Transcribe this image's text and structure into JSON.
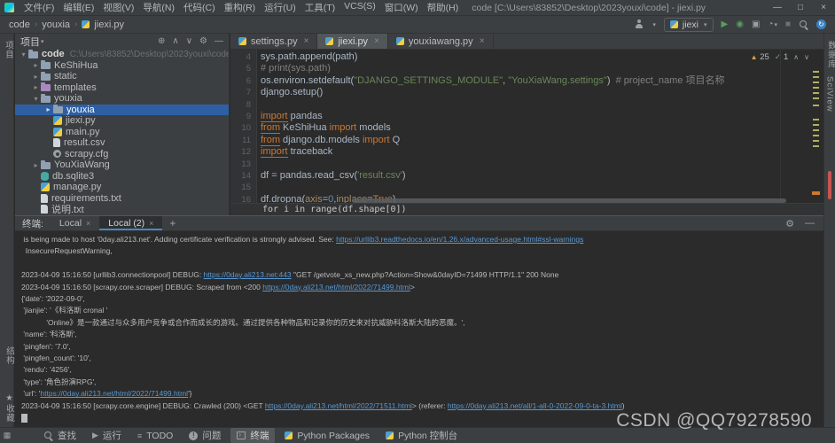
{
  "window": {
    "title": "code [C:\\Users\\83852\\Desktop\\2023youxi\\code] - jiexi.py",
    "menus": [
      "文件(F)",
      "编辑(E)",
      "视图(V)",
      "导航(N)",
      "代码(C)",
      "重构(R)",
      "运行(U)",
      "工具(T)",
      "VCS(S)",
      "窗口(W)",
      "帮助(H)"
    ],
    "controls": {
      "minimize": "—",
      "maximize": "□",
      "close": "×"
    }
  },
  "navbar": {
    "breadcrumbs": [
      "code",
      "youxia",
      "jiexi.py"
    ],
    "run_config": "jiexi"
  },
  "left_stripe": {
    "top": "项目",
    "bottom1": "结构",
    "bottom2": "收藏",
    "star": "★"
  },
  "right_stripe": {
    "labels": [
      "数据库",
      "SciView"
    ]
  },
  "project": {
    "header": "项目",
    "header_icons": [
      "⊕",
      "∧",
      "∨",
      "⚙",
      "—"
    ],
    "tree": [
      {
        "label": "code",
        "path": "C:\\Users\\83852\\Desktop\\2023youxi\\code",
        "level": 0,
        "icon": "folder",
        "chev": "v",
        "bold": true
      },
      {
        "label": "KeShiHua",
        "level": 1,
        "icon": "folder",
        "chev": ">"
      },
      {
        "label": "static",
        "level": 1,
        "icon": "folder",
        "chev": ">"
      },
      {
        "label": "templates",
        "level": 1,
        "icon": "folder-purple",
        "chev": ">"
      },
      {
        "label": "youxia",
        "level": 1,
        "icon": "folder",
        "chev": "v"
      },
      {
        "label": "youxia",
        "level": 2,
        "icon": "folder",
        "chev": ">",
        "selected": true
      },
      {
        "label": "jiexi.py",
        "level": 2,
        "icon": "py"
      },
      {
        "label": "main.py",
        "level": 2,
        "icon": "py"
      },
      {
        "label": "result.csv",
        "level": 2,
        "icon": "file"
      },
      {
        "label": "scrapy.cfg",
        "level": 2,
        "icon": "cfg"
      },
      {
        "label": "YouXiaWang",
        "level": 1,
        "icon": "folder",
        "chev": ">"
      },
      {
        "label": "db.sqlite3",
        "level": 1,
        "icon": "db"
      },
      {
        "label": "manage.py",
        "level": 1,
        "icon": "py"
      },
      {
        "label": "requirements.txt",
        "level": 1,
        "icon": "file"
      },
      {
        "label": "说明.txt",
        "level": 1,
        "icon": "file"
      }
    ]
  },
  "editor": {
    "tabs": [
      {
        "label": "settings.py"
      },
      {
        "label": "jiexi.py",
        "active": true
      },
      {
        "label": "youxiawang.py"
      }
    ],
    "warnings": "25",
    "ok": "1",
    "sticky_line": "for i in range(df.shape[0])",
    "lines": [
      {
        "num": "4",
        "seg": [
          {
            "k": "p",
            "t": "sys.path.append(path)"
          }
        ]
      },
      {
        "num": "5",
        "seg": [
          {
            "k": "c",
            "t": "# print(sys.path)"
          }
        ]
      },
      {
        "num": "6",
        "seg": [
          {
            "k": "p",
            "t": "os.environ.setdefault("
          },
          {
            "k": "s",
            "t": "\"DJANGO_SETTINGS_MODULE\""
          },
          {
            "k": "p",
            "t": ", "
          },
          {
            "k": "s",
            "t": "\"YouXiaWang.settings\""
          },
          {
            "k": "p",
            "t": ")  "
          },
          {
            "k": "c",
            "t": "# project_name 项目名称"
          }
        ]
      },
      {
        "num": "7",
        "seg": [
          {
            "k": "p",
            "t": "django.setup()"
          }
        ]
      },
      {
        "num": "8",
        "seg": []
      },
      {
        "num": "9",
        "seg": [
          {
            "k": "ku",
            "t": "import"
          },
          {
            "k": "p",
            "t": " pandas"
          }
        ]
      },
      {
        "num": "10",
        "seg": [
          {
            "k": "ku",
            "t": "from"
          },
          {
            "k": "p",
            "t": " KeShiHua "
          },
          {
            "k": "k",
            "t": "import"
          },
          {
            "k": "p",
            "t": " models"
          }
        ]
      },
      {
        "num": "11",
        "seg": [
          {
            "k": "ku",
            "t": "from"
          },
          {
            "k": "p",
            "t": " django.db.models "
          },
          {
            "k": "k",
            "t": "import"
          },
          {
            "k": "p",
            "t": " Q"
          }
        ]
      },
      {
        "num": "12",
        "seg": [
          {
            "k": "ku",
            "t": "import"
          },
          {
            "k": "p",
            "t": " traceback"
          }
        ]
      },
      {
        "num": "13",
        "seg": []
      },
      {
        "num": "14",
        "seg": [
          {
            "k": "p",
            "t": "df = pandas.read_csv("
          },
          {
            "k": "s",
            "t": "'result.csv'"
          },
          {
            "k": "p",
            "t": ")"
          }
        ]
      },
      {
        "num": "15",
        "seg": []
      },
      {
        "num": "16",
        "seg": [
          {
            "k": "p",
            "t": "df.dropna("
          },
          {
            "k": "a",
            "t": "axis"
          },
          {
            "k": "p",
            "t": "="
          },
          {
            "k": "n",
            "t": "0"
          },
          {
            "k": "p",
            "t": ","
          },
          {
            "k": "a",
            "t": "inplace"
          },
          {
            "k": "p",
            "t": "="
          },
          {
            "k": "k",
            "t": "True"
          },
          {
            "k": "p",
            "t": ")"
          }
        ]
      }
    ]
  },
  "console": {
    "panel_label": "终端:",
    "tabs": [
      {
        "label": "Local"
      },
      {
        "label": "Local (2)",
        "active": true
      }
    ],
    "lines": [
      [
        {
          "k": "t",
          "t": " is being made to host '0day.ali213.net'. Adding certificate verification is strongly advised. See: "
        },
        {
          "k": "l",
          "t": "https://urllib3.readthedocs.io/en/1.26.x/advanced-usage.html#ssl-warnings"
        }
      ],
      [
        {
          "k": "t",
          "t": "  InsecureRequestWarning,"
        }
      ],
      [],
      [
        {
          "k": "t",
          "t": "2023-04-09 15:16:50 [urllib3.connectionpool] DEBUG: "
        },
        {
          "k": "l",
          "t": "https://0day.ali213.net:443"
        },
        {
          "k": "t",
          "t": " \"GET /getvote_xs_new.php?Action=Show&0dayID=71499 HTTP/1.1\" 200 None"
        }
      ],
      [
        {
          "k": "t",
          "t": "2023-04-09 15:16:50 [scrapy.core.scraper] DEBUG: Scraped from <200 "
        },
        {
          "k": "l",
          "t": "https://0day.ali213.net/html/2022/71499.html"
        },
        {
          "k": "t",
          "t": ">"
        }
      ],
      [
        {
          "k": "t",
          "t": "{'date': '2022-09-0',"
        }
      ],
      [
        {
          "k": "t",
          "t": " 'jianjie': '《科洛斯 cronal '"
        }
      ],
      [
        {
          "k": "t",
          "t": "            'Online》是一款通过与众多用户竞争或合作而成长的游戏。通过提供各种物品和记录你的历史来对抗威胁科洛斯大陆的恶魔。',"
        }
      ],
      [
        {
          "k": "t",
          "t": " 'name': '科洛斯',"
        }
      ],
      [
        {
          "k": "t",
          "t": " 'pingfen': '7.0',"
        }
      ],
      [
        {
          "k": "t",
          "t": " 'pingfen_count': '10',"
        }
      ],
      [
        {
          "k": "t",
          "t": " 'rendu': '4256',"
        }
      ],
      [
        {
          "k": "t",
          "t": " 'type': '角色扮演RPG',"
        }
      ],
      [
        {
          "k": "t",
          "t": " 'url': '"
        },
        {
          "k": "l",
          "t": "https://0day.ali213.net/html/2022/71499.html"
        },
        {
          "k": "t",
          "t": "'}"
        }
      ],
      [
        {
          "k": "t",
          "t": "2023-04-09 15:16:50 [scrapy.core.engine] DEBUG: Crawled (200) <GET "
        },
        {
          "k": "l",
          "t": "https://0day.ali213.net/html/2022/71511.html"
        },
        {
          "k": "t",
          "t": "> (referer: "
        },
        {
          "k": "l",
          "t": "https://0day.ali213.net/all/1-all-0-2022-09-0-ta-3.html"
        },
        {
          "k": "t",
          "t": ")"
        }
      ]
    ]
  },
  "bottom_bar": {
    "items": [
      {
        "icon": "search",
        "label": "查找"
      },
      {
        "icon": "run",
        "label": "运行"
      },
      {
        "icon": "todo",
        "label": "TODO"
      },
      {
        "icon": "prob",
        "label": "问题"
      },
      {
        "icon": "term",
        "label": "终端",
        "active": true
      },
      {
        "icon": "python",
        "label": "Python Packages"
      },
      {
        "icon": "python",
        "label": "Python 控制台"
      }
    ]
  },
  "watermark": "CSDN @QQ79278590",
  "colors": {
    "accent_blue": "#4a88c7",
    "selection": "#2e5fa3",
    "link": "#5899d4",
    "warning": "#d9a343",
    "error_stripe": "#c75450"
  }
}
